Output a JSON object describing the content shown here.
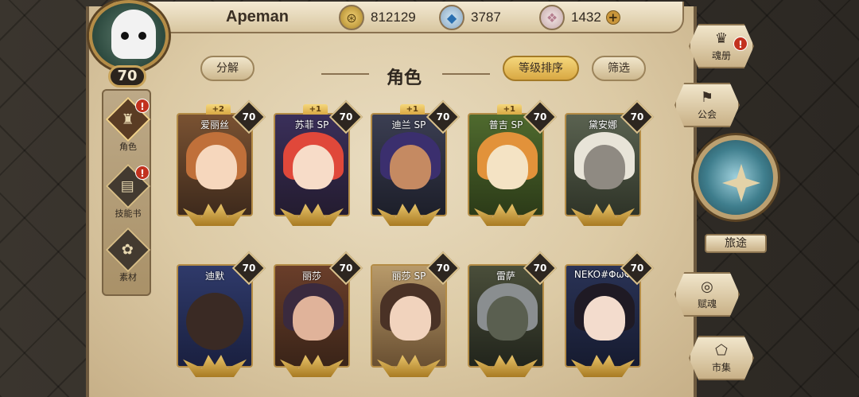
{
  "player": {
    "name": "Apeman",
    "level": "70"
  },
  "currencies": [
    {
      "icon": "gold-coin-icon",
      "value": "812129"
    },
    {
      "icon": "blue-gem-icon",
      "value": "3787"
    },
    {
      "icon": "crystal-icon",
      "value": "1432"
    }
  ],
  "header": {
    "title": "角色",
    "disassemble_label": "分解",
    "sort_label": "等级排序",
    "filter_label": "筛选"
  },
  "left_nav": [
    {
      "label": "角色",
      "active": true,
      "alert": "!"
    },
    {
      "label": "技能书",
      "active": false,
      "alert": "!"
    },
    {
      "label": "素材",
      "active": false,
      "alert": ""
    }
  ],
  "right_nav": {
    "collection_label": "魂册",
    "collection_alert": "!",
    "guild_label": "公会",
    "journey_label": "旅途",
    "soul_label": "赋魂",
    "market_label": "市集"
  },
  "characters": [
    {
      "name": "爱丽丝",
      "level": "70",
      "bonus": "+2"
    },
    {
      "name": "苏菲 SP",
      "level": "70",
      "bonus": "+1"
    },
    {
      "name": "迪兰 SP",
      "level": "70",
      "bonus": "+1"
    },
    {
      "name": "普吉 SP",
      "level": "70",
      "bonus": "+1"
    },
    {
      "name": "黛安娜",
      "level": "70",
      "bonus": ""
    },
    {
      "name": "迪默",
      "level": "70",
      "bonus": ""
    },
    {
      "name": "丽莎",
      "level": "70",
      "bonus": ""
    },
    {
      "name": "丽莎 SP",
      "level": "70",
      "bonus": ""
    },
    {
      "name": "雷萨",
      "level": "70",
      "bonus": ""
    },
    {
      "name": "NEKO#ΦωΦ",
      "level": "70",
      "bonus": ""
    }
  ],
  "colors": {
    "gold_accent": "#d9a843",
    "alert_red": "#c2321f",
    "parchment": "#e9dcc0"
  }
}
